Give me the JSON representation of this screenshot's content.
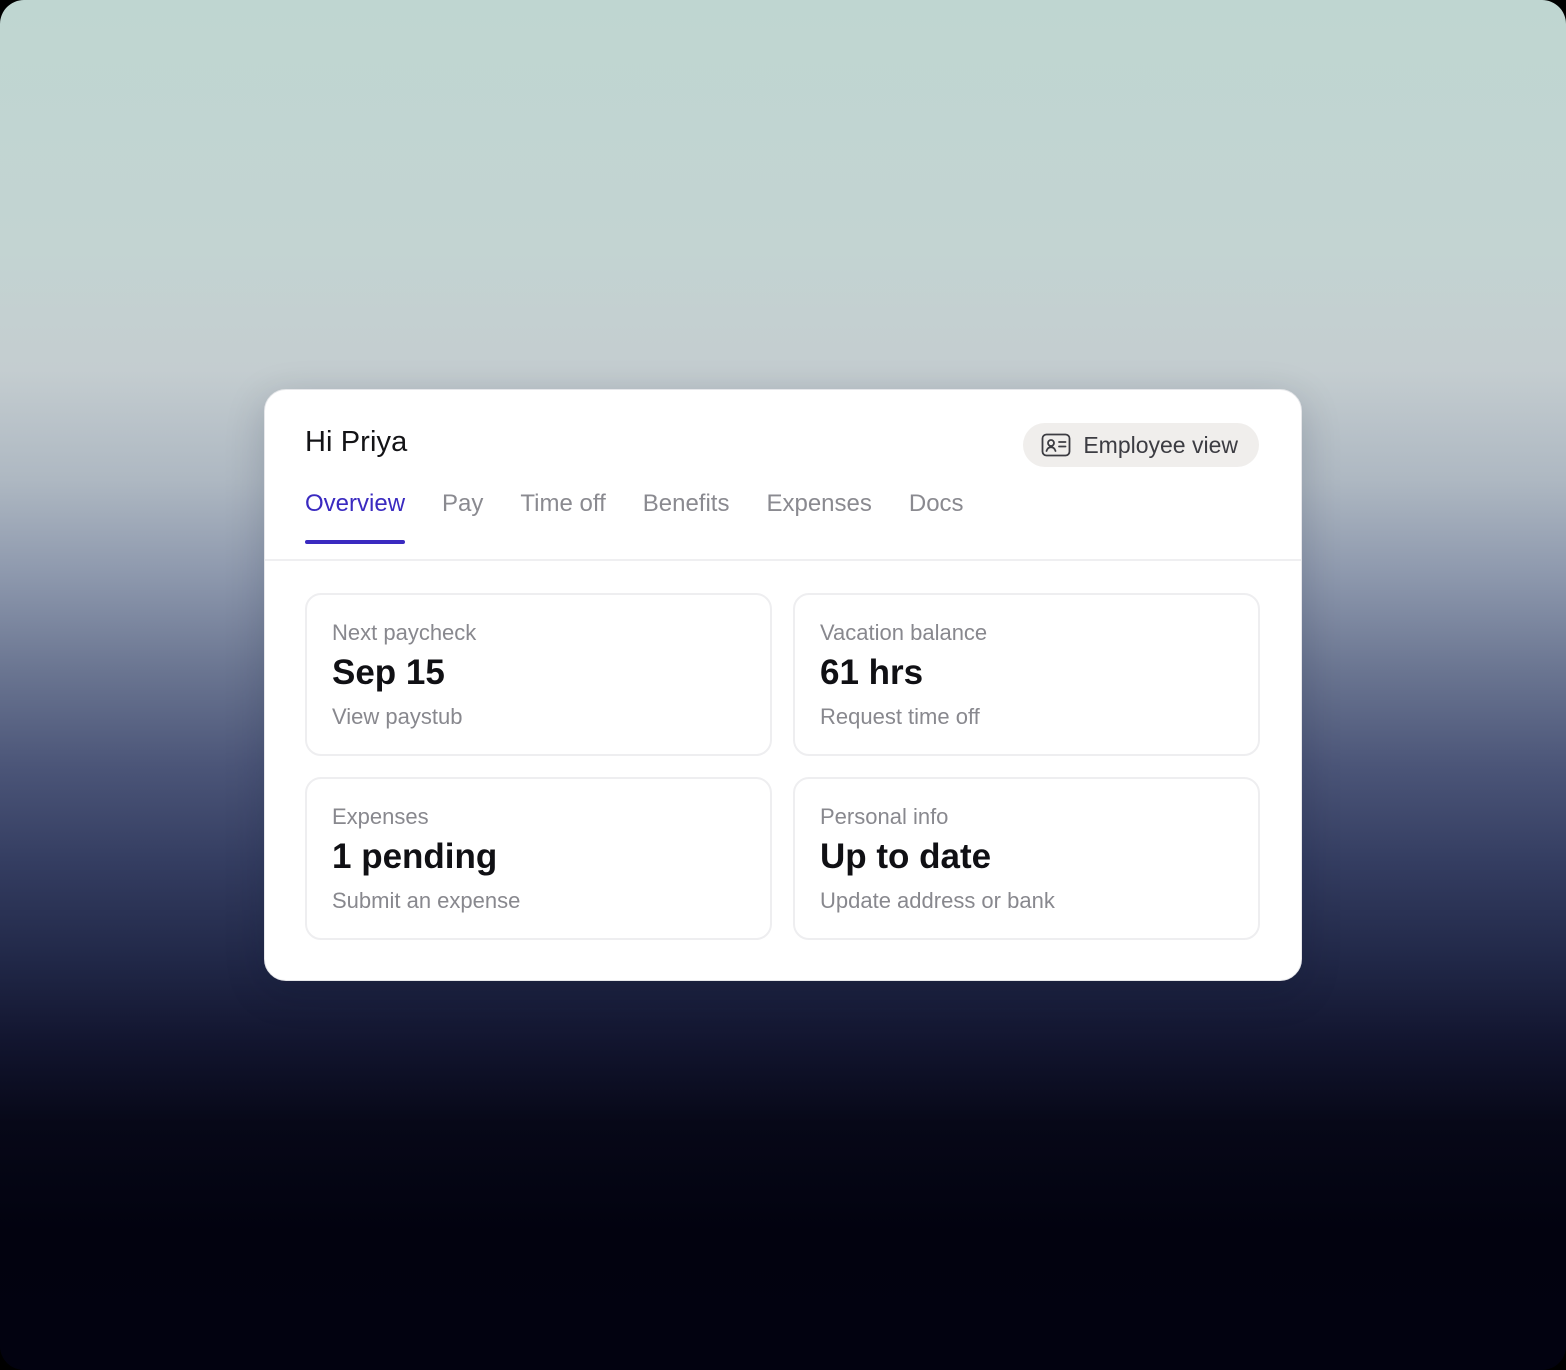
{
  "header": {
    "greeting": "Hi Priya",
    "view_toggle": {
      "label": "Employee view",
      "icon": "id-card-icon"
    }
  },
  "tabs": [
    {
      "label": "Overview",
      "active": true
    },
    {
      "label": "Pay",
      "active": false
    },
    {
      "label": "Time off",
      "active": false
    },
    {
      "label": "Benefits",
      "active": false
    },
    {
      "label": "Expenses",
      "active": false
    },
    {
      "label": "Docs",
      "active": false
    }
  ],
  "tiles": [
    {
      "label": "Next paycheck",
      "value": "Sep 15",
      "action": "View paystub"
    },
    {
      "label": "Vacation balance",
      "value": "61 hrs",
      "action": "Request time off"
    },
    {
      "label": "Expenses",
      "value": "1 pending",
      "action": "Submit an expense"
    },
    {
      "label": "Personal info",
      "value": "Up to date",
      "action": "Update address or bank"
    }
  ],
  "colors": {
    "accent": "#3a2ac0",
    "text_primary": "#131316",
    "text_muted": "#88888e",
    "pill_background": "#f0eeec"
  }
}
